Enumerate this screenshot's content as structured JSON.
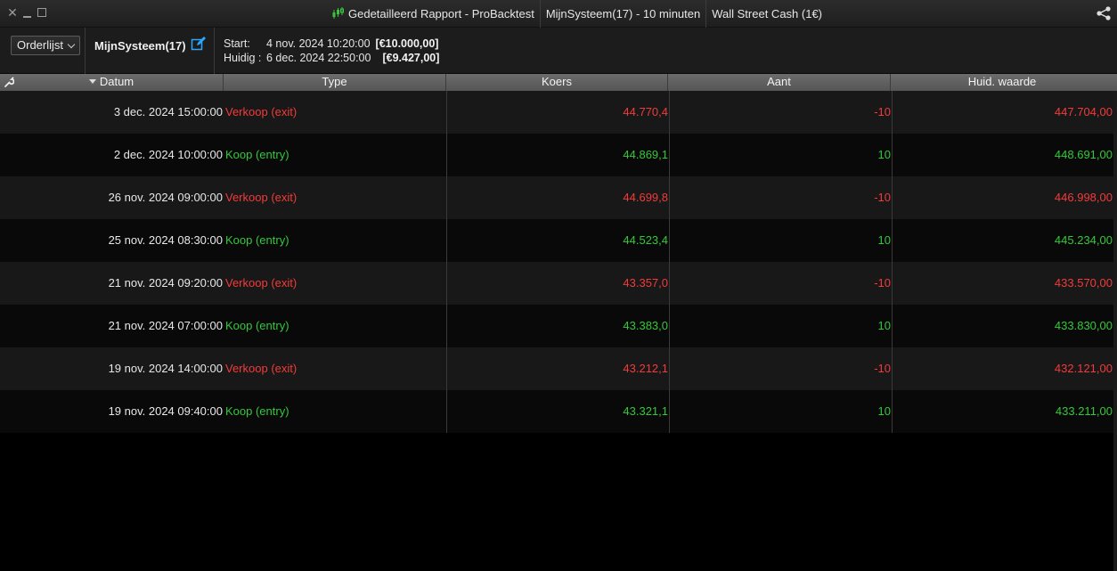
{
  "window": {
    "title": "Gedetailleerd Rapport - ProBacktest",
    "system_tab": "MijnSysteem(17) - 10 minuten",
    "instrument": "Wall Street Cash (1€)",
    "icons": [
      "close-icon",
      "minimize-icon",
      "maximize-icon",
      "candlestick-icon",
      "share-icon"
    ]
  },
  "toolbar": {
    "dropdown_label": "Orderlijst",
    "system_name": "MijnSysteem(17)",
    "start_label": "Start:",
    "start_date": "4 nov. 2024 10:20:00",
    "start_value": "[€10.000,00]",
    "current_label": "Huidig :",
    "current_date": "6 dec. 2024 22:50:00",
    "current_value": "[€9.427,00]"
  },
  "table": {
    "columns": [
      "Datum",
      "Type",
      "Koers",
      "Aant",
      "Huid. waarde"
    ],
    "rows": [
      {
        "date": "3 dec. 2024 15:00:00",
        "type": "Verkoop (exit)",
        "price": "44.770,4",
        "qty": "-10",
        "value": "447.704,00",
        "side": "sell"
      },
      {
        "date": "2 dec. 2024 10:00:00",
        "type": "Koop (entry)",
        "price": "44.869,1",
        "qty": "10",
        "value": "448.691,00",
        "side": "buy"
      },
      {
        "date": "26 nov. 2024 09:00:00",
        "type": "Verkoop (exit)",
        "price": "44.699,8",
        "qty": "-10",
        "value": "446.998,00",
        "side": "sell"
      },
      {
        "date": "25 nov. 2024 08:30:00",
        "type": "Koop (entry)",
        "price": "44.523,4",
        "qty": "10",
        "value": "445.234,00",
        "side": "buy"
      },
      {
        "date": "21 nov. 2024 09:20:00",
        "type": "Verkoop (exit)",
        "price": "43.357,0",
        "qty": "-10",
        "value": "433.570,00",
        "side": "sell"
      },
      {
        "date": "21 nov. 2024 07:00:00",
        "type": "Koop (entry)",
        "price": "43.383,0",
        "qty": "10",
        "value": "433.830,00",
        "side": "buy"
      },
      {
        "date": "19 nov. 2024 14:00:00",
        "type": "Verkoop (exit)",
        "price": "43.212,1",
        "qty": "-10",
        "value": "432.121,00",
        "side": "sell"
      },
      {
        "date": "19 nov. 2024 09:40:00",
        "type": "Koop (entry)",
        "price": "43.321,1",
        "qty": "10",
        "value": "433.211,00",
        "side": "buy"
      }
    ]
  },
  "colors": {
    "sell": "#f23b3b",
    "buy": "#34c83a",
    "header_bg": "#606060",
    "accent_blue": "#2aa7ff"
  }
}
